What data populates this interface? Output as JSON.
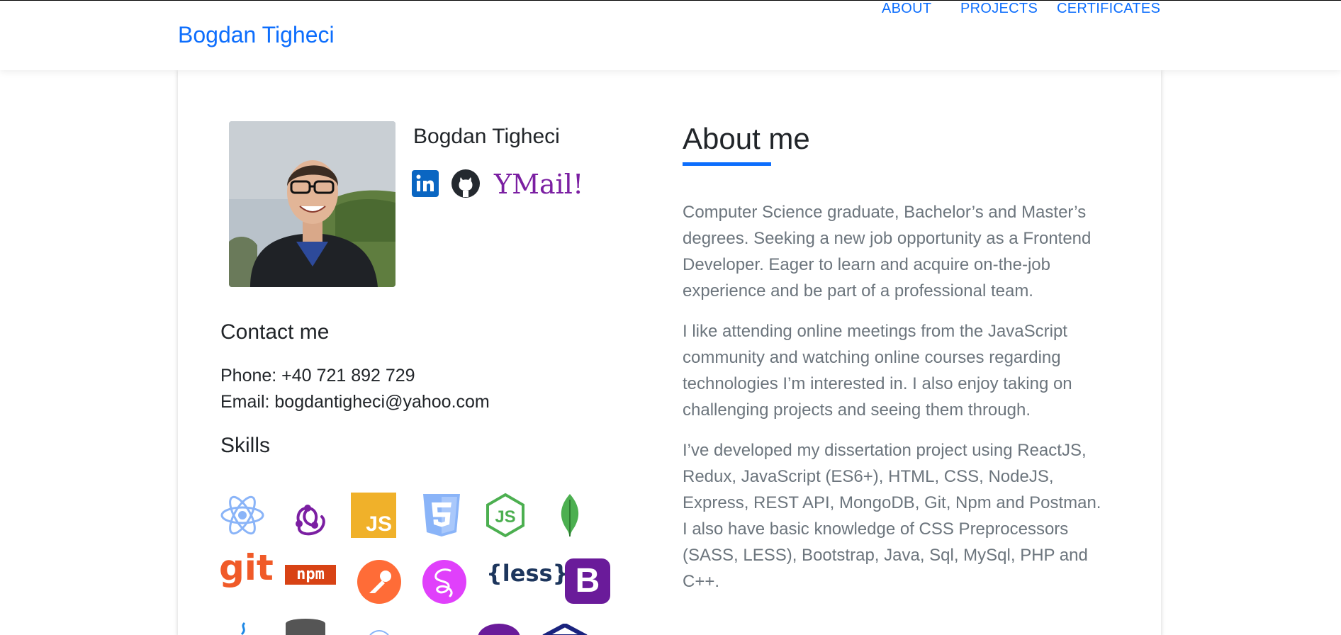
{
  "navbar": {
    "brand": "Bogdan Tigheci",
    "links": [
      "ABOUT",
      "PROJECTS",
      "CERTIFICATES"
    ]
  },
  "profile": {
    "name": "Bogdan Tigheci",
    "social": {
      "linkedin_icon": "linkedin-icon",
      "github_icon": "github-icon",
      "ymail_text": "YMail!"
    }
  },
  "contact": {
    "title": "Contact me",
    "phone": "Phone: +40 721 892 729",
    "email": "Email: bogdantigheci@yahoo.com"
  },
  "skills": {
    "title": "Skills",
    "icons": [
      "react-icon",
      "redux-icon",
      "javascript-icon",
      "css3-icon",
      "nodejs-icon",
      "mongodb-icon",
      "git-icon",
      "npm-icon",
      "postman-icon",
      "sass-icon",
      "less-icon",
      "bootstrap-icon",
      "java-icon",
      "mysql-icon",
      "c-plus-plus-icon"
    ],
    "less_label": "{less}",
    "git_label": "git",
    "npm_label": "npm",
    "js_label": "JS",
    "bootstrap_label": "B"
  },
  "about": {
    "title": "About me",
    "paragraphs": [
      "Computer Science graduate, Bachelor’s and Master’s degrees. Seeking a new job opportunity as a Frontend Developer. Eager to learn and acquire on-the-job experience and be part of a professional team.",
      "I like attending online meetings from the JavaScript community and watching online courses regarding technologies I’m interested in. I also enjoy taking on challenging projects and seeing them through.",
      "I’ve developed my dissertation project using ReactJS, Redux, JavaScript (ES6+), HTML, CSS, NodeJS, Express, REST API, MongoDB, Git, Npm and Postman. I also have basic knowledge of CSS Preprocessors (SASS, LESS), Bootstrap, Java, Sql, MySql, PHP and C++."
    ]
  },
  "colors": {
    "accent": "#0d6efd",
    "text": "#212529",
    "muted": "#6c757d",
    "ymail_purple": "#7b1fa2"
  }
}
